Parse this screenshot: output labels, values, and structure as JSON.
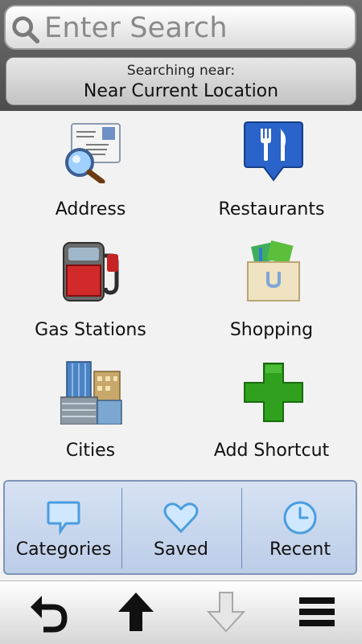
{
  "search": {
    "placeholder": "Enter Search",
    "icon": "search-icon"
  },
  "location": {
    "label": "Searching near:",
    "value": "Near Current Location"
  },
  "categories": [
    {
      "label": "Address",
      "icon": "address-card-magnifier-icon"
    },
    {
      "label": "Restaurants",
      "icon": "fork-knife-pin-icon"
    },
    {
      "label": "Gas Stations",
      "icon": "gas-pump-icon"
    },
    {
      "label": "Shopping",
      "icon": "shopping-bag-icon"
    },
    {
      "label": "Cities",
      "icon": "city-buildings-icon"
    },
    {
      "label": "Add Shortcut",
      "icon": "green-plus-icon"
    }
  ],
  "tabs": [
    {
      "label": "Categories",
      "icon": "speech-bubble-icon"
    },
    {
      "label": "Saved",
      "icon": "heart-icon"
    },
    {
      "label": "Recent",
      "icon": "clock-icon"
    }
  ],
  "toolbar": {
    "back_icon": "back-arrow-icon",
    "up_icon": "up-arrow-icon",
    "down_icon": "down-arrow-icon",
    "menu_icon": "menu-icon"
  },
  "colors": {
    "header": "#5a5a5a",
    "tab_panel": "#c9d7ee",
    "tab_border": "#7f95b9",
    "plus_green": "#2fa11e",
    "pin_blue": "#2a63c9"
  }
}
